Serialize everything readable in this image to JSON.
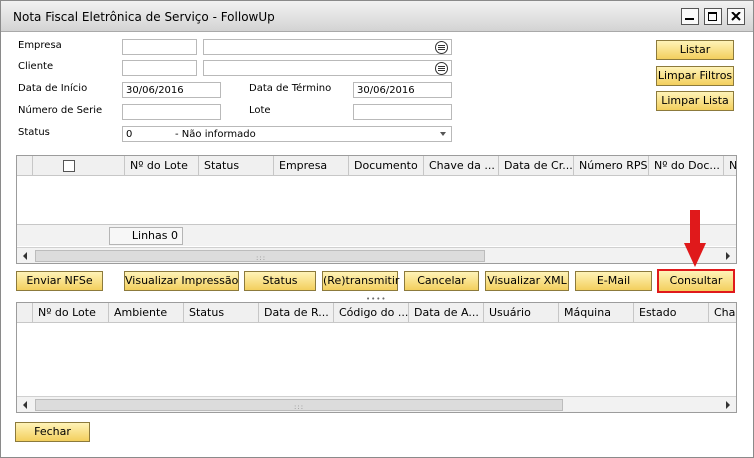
{
  "window": {
    "title": "Nota Fiscal Eletrônica de Serviço - FollowUp"
  },
  "filters": {
    "empresa_label": "Empresa",
    "empresa_code": "",
    "empresa_name": "",
    "cliente_label": "Cliente",
    "cliente_code": "",
    "cliente_name": "",
    "data_inicio_label": "Data de Início",
    "data_inicio_value": "30/06/2016",
    "data_termino_label": "Data de Término",
    "data_termino_value": "30/06/2016",
    "numero_serie_label": "Número de Serie",
    "numero_serie_value": "",
    "lote_label": "Lote",
    "lote_value": "",
    "status_label": "Status",
    "status_code": "0",
    "status_text": "- Não informado"
  },
  "side_buttons": {
    "listar": "Listar",
    "limpar_filtros": "Limpar Filtros",
    "limpar_lista": "Limpar Lista"
  },
  "grid_top": {
    "columns": [
      "Nº do Lote",
      "Status",
      "Empresa",
      "Documento",
      "Chave da ...",
      "Data de Cr...",
      "Número RPS",
      "Nº do Doc...",
      "Nº d"
    ],
    "linhas_label": "Linhas 0"
  },
  "action_buttons": {
    "enviar": "Enviar NFSe",
    "visualizar_impressao": "Visualizar Impressão",
    "status": "Status",
    "retransmitir": "(Re)transmitir",
    "cancelar": "Cancelar",
    "visualizar_xml": "Visualizar XML",
    "email": "E-Mail",
    "consultar": "Consultar"
  },
  "grid_bottom": {
    "columns": [
      "Nº do Lote",
      "Ambiente",
      "Status",
      "Data de R...",
      "Código do ...",
      "Data de A...",
      "Usuário",
      "Máquina",
      "Estado",
      "Cha"
    ]
  },
  "footer": {
    "fechar": "Fechar"
  },
  "colors": {
    "button_top": "#fff3b8",
    "button_bottom": "#f3cf5e",
    "highlight_border": "#e0191b",
    "annotation_arrow": "#e0191b"
  },
  "icons": [
    "minimize-icon",
    "maximize-icon",
    "close-icon",
    "lookup-icon",
    "dropdown-arrow-icon",
    "scroll-left-icon",
    "scroll-right-icon",
    "down-arrow-annotation-icon"
  ]
}
